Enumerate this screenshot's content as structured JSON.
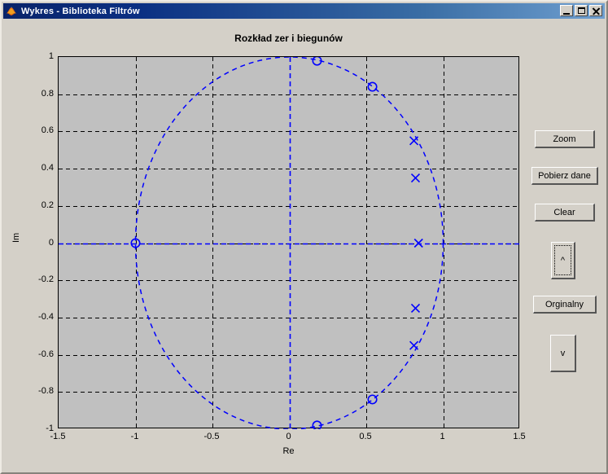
{
  "window": {
    "title": "Wykres - Biblioteka Filtrów",
    "icon": "matlab-membrane-icon",
    "controls": {
      "minimize": "_",
      "maximize": "□",
      "close": "×"
    },
    "colors": {
      "face": "#d4d0c8",
      "title_active_left": "#0a246a",
      "title_active_right": "#6f9fd0",
      "plot_background": "#c0c0c0",
      "data_blue": "#0000ff",
      "grid_black": "#000000"
    }
  },
  "buttons": [
    {
      "label": "Zoom",
      "name": "zoom-button",
      "focused": false
    },
    {
      "label": "Pobierz dane",
      "name": "fetch-data-button",
      "focused": false
    },
    {
      "label": "Clear",
      "name": "clear-button",
      "focused": false
    },
    {
      "label": "^",
      "name": "scroll-up-button",
      "focused": true
    },
    {
      "label": "Orginalny",
      "name": "original-button",
      "focused": false
    },
    {
      "label": "v",
      "name": "scroll-down-button",
      "focused": false
    }
  ],
  "chart_data": {
    "type": "scatter",
    "title": "Rozkład zer i biegunów",
    "xlabel": "Re",
    "ylabel": "Im",
    "xlim": [
      -1.5,
      1.5
    ],
    "ylim": [
      -1.0,
      1.0
    ],
    "xticks": [
      -1.5,
      -1,
      -0.5,
      0,
      0.5,
      1,
      1.5
    ],
    "xticklabels": [
      "-1.5",
      "-1",
      "-0.5",
      "0",
      "0.5",
      "1",
      "1.5"
    ],
    "yticks": [
      1,
      0.8,
      0.6,
      0.4,
      0.2,
      0,
      -0.2,
      -0.4,
      -0.6,
      -0.8,
      -1
    ],
    "yticklabels": [
      "1",
      "0.8",
      "0.6",
      "0.4",
      "0.2",
      "0",
      "-0.2",
      "-0.4",
      "-0.6",
      "-0.8",
      "-1"
    ],
    "grid": true,
    "grid_style": "dashed",
    "legend": null,
    "series": [
      {
        "name": "zeros",
        "marker": "o",
        "color": "#0000ff",
        "points": [
          {
            "x": -1.0,
            "y": 0.0
          },
          {
            "x": 0.18,
            "y": 0.98
          },
          {
            "x": 0.54,
            "y": 0.84
          },
          {
            "x": 0.54,
            "y": -0.84
          },
          {
            "x": 0.18,
            "y": -0.98
          }
        ]
      },
      {
        "name": "poles",
        "marker": "x",
        "color": "#0000ff",
        "points": [
          {
            "x": 0.81,
            "y": 0.55
          },
          {
            "x": 0.82,
            "y": 0.35
          },
          {
            "x": 0.84,
            "y": 0.0
          },
          {
            "x": 0.82,
            "y": -0.35
          },
          {
            "x": 0.81,
            "y": -0.55
          }
        ]
      },
      {
        "name": "unit-circle",
        "marker": "none",
        "style": "dashed",
        "color": "#0000ff",
        "radius": 1.0,
        "center": {
          "x": 0.0,
          "y": 0.0
        }
      },
      {
        "name": "real-axis-line",
        "marker": "none",
        "style": "dashed",
        "color": "#0000ff",
        "y": 0.0
      },
      {
        "name": "imag-axis-line",
        "marker": "none",
        "style": "dashed",
        "color": "#0000ff",
        "x": 0.0
      }
    ]
  }
}
